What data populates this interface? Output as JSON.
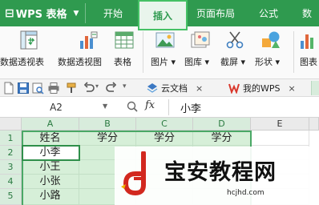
{
  "app": {
    "name": "WPS 表格"
  },
  "menu": {
    "tabs": [
      "开始",
      "插入",
      "页面布局",
      "公式",
      "数"
    ],
    "active": "插入"
  },
  "ribbon": {
    "pivot_table": "数据透视表",
    "pivot_chart": "数据透视图",
    "table": "表格",
    "picture": "图片",
    "gallery": "图库",
    "screenshot": "截屏",
    "shape": "形状",
    "chart": "图表"
  },
  "doc_tabs": [
    {
      "label": "云文档",
      "close": "×"
    },
    {
      "label": "我的WPS",
      "close": "×"
    }
  ],
  "formula_bar": {
    "cell_ref": "A2",
    "fx": "fx",
    "value": "小李"
  },
  "grid": {
    "columns": [
      "A",
      "B",
      "C",
      "D",
      "E"
    ],
    "rows": [
      "1",
      "2",
      "3",
      "4",
      "5"
    ],
    "header_row": [
      "姓名",
      "学分",
      "学分",
      "学分",
      ""
    ],
    "names": [
      "小李",
      "小王",
      "小张",
      "小路"
    ]
  },
  "watermark": {
    "title": "宝安教程网",
    "url": "hcjhd.com"
  },
  "colors": {
    "brand": "#2f9a4f",
    "accent": "#45c165",
    "selection": "#d6efd8"
  }
}
